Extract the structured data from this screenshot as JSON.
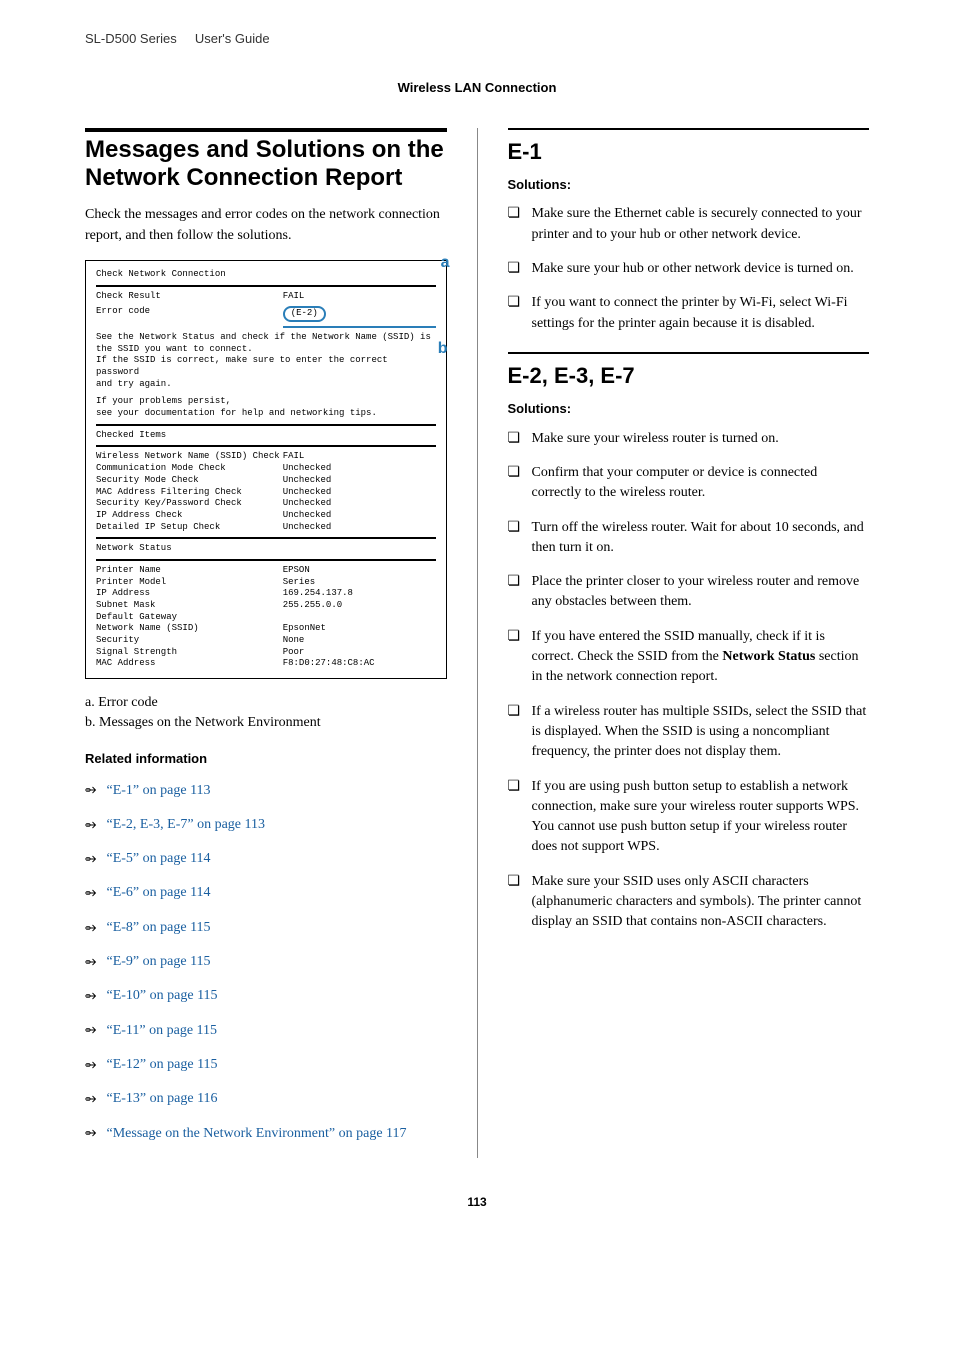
{
  "header": {
    "product": "SL-D500 Series",
    "doc": "User's Guide",
    "section": "Wireless LAN Connection"
  },
  "left": {
    "title": "Messages and Solutions on the Network Connection Report",
    "intro": "Check the messages and error codes on the network connection report, and then follow the solutions.",
    "report": {
      "heading": "Check Network Connection",
      "result_label": "Check Result",
      "result_value": "FAIL",
      "error_label": "Error code",
      "error_value": "(E-2)",
      "msg1": "See the Network Status and check if the Network Name (SSID) is",
      "msg2": "the SSID you want to connect.",
      "msg3": "If the SSID is correct, make sure to enter the correct password",
      "msg4": "and try again.",
      "msg5": "If your problems persist,",
      "msg6": "see your documentation for help and networking tips.",
      "checked_items": "Checked Items",
      "items": [
        {
          "k": "Wireless Network Name (SSID) Check",
          "v": "FAIL"
        },
        {
          "k": "Communication Mode Check",
          "v": "Unchecked"
        },
        {
          "k": "Security Mode Check",
          "v": "Unchecked"
        },
        {
          "k": "MAC Address Filtering Check",
          "v": "Unchecked"
        },
        {
          "k": "Security Key/Password Check",
          "v": "Unchecked"
        },
        {
          "k": "IP Address Check",
          "v": "Unchecked"
        },
        {
          "k": "Detailed IP Setup Check",
          "v": "Unchecked"
        }
      ],
      "status_heading": "Network Status",
      "status": [
        {
          "k": "Printer Name",
          "v": "EPSON"
        },
        {
          "k": "Printer Model",
          "v": "Series"
        },
        {
          "k": "IP Address",
          "v": "169.254.137.8"
        },
        {
          "k": "Subnet Mask",
          "v": "255.255.0.0"
        },
        {
          "k": "Default Gateway",
          "v": ""
        },
        {
          "k": "Network Name (SSID)",
          "v": "EpsonNet"
        },
        {
          "k": "Security",
          "v": "None"
        },
        {
          "k": "Signal Strength",
          "v": "Poor"
        },
        {
          "k": "MAC Address",
          "v": "F8:D0:27:48:C8:AC"
        }
      ],
      "callout_a": "a",
      "callout_b": "b"
    },
    "legend_a": "a. Error code",
    "legend_b": "b. Messages on the Network Environment",
    "related_info": "Related information",
    "links": [
      "“E-1” on page 113",
      "“E-2, E-3, E-7” on page 113",
      "“E-5” on page 114",
      "“E-6” on page 114",
      "“E-8” on page 115",
      "“E-9” on page 115",
      "“E-10” on page 115",
      "“E-11” on page 115",
      "“E-12” on page 115",
      "“E-13” on page 116",
      "“Message on the Network Environment” on page 117"
    ]
  },
  "right": {
    "e1": {
      "heading": "E-1",
      "label": "Solutions:",
      "bullets": [
        "Make sure the Ethernet cable is securely connected to your printer and to your hub or other network device.",
        "Make sure your hub or other network device is turned on.",
        "If you want to connect the printer by Wi-Fi, select Wi-Fi settings for the printer again because it is disabled."
      ]
    },
    "e237": {
      "heading": "E-2, E-3, E-7",
      "label": "Solutions:",
      "bullets": [
        "Make sure your wireless router is turned on.",
        "Confirm that your computer or device is connected correctly to the wireless router.",
        "Turn off the wireless router. Wait for about 10 seconds, and then turn it on.",
        "Place the printer closer to your wireless router and remove any obstacles between them.",
        "If you have entered the SSID manually, check if it is correct. Check the SSID from the Network Status section in the network connection report.",
        "If a wireless router has multiple SSIDs, select the SSID that is displayed. When the SSID is using a noncompliant frequency, the printer does not display them.",
        "If you are using push button setup to establish a network connection, make sure your wireless router supports WPS. You cannot use push button setup if your wireless router does not support WPS.",
        "Make sure your SSID uses only ASCII characters (alphanumeric characters and symbols). The printer cannot display an SSID that contains non-ASCII characters."
      ]
    }
  },
  "footer": {
    "page": "113"
  }
}
